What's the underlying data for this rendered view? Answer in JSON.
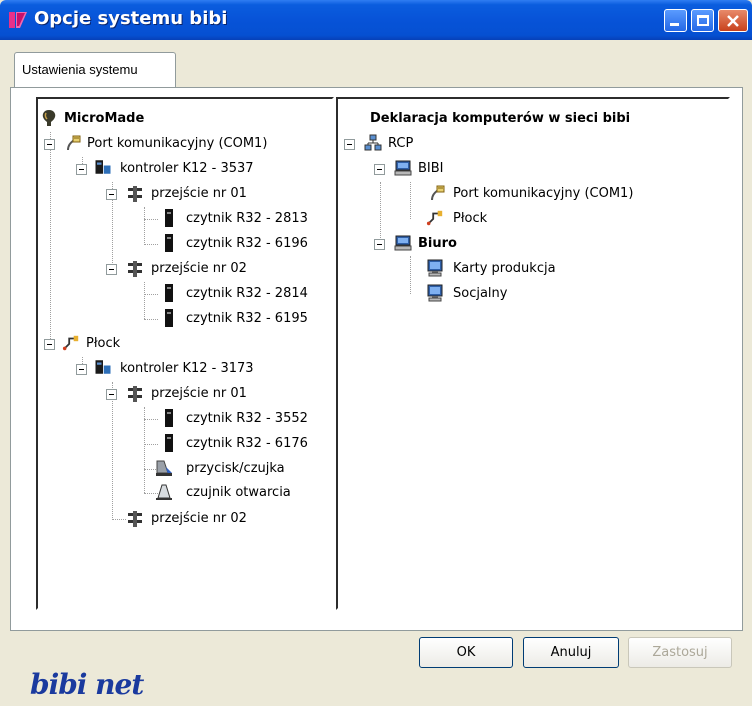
{
  "window": {
    "title": "Opcje systemu bibi"
  },
  "tabs": [
    {
      "label": "Ustawienia systemu"
    }
  ],
  "left_tree": {
    "root": "MicroMade",
    "nodes": [
      {
        "label": "Port komunikacyjny (COM1)",
        "icon": "serial-port-icon"
      },
      {
        "label": "kontroler K12 - 3537",
        "icon": "controller-icon"
      },
      {
        "label": "przejście nr 01",
        "icon": "passage-icon"
      },
      {
        "label": "czytnik R32 - 2813",
        "icon": "reader-icon"
      },
      {
        "label": "czytnik R32 - 6196",
        "icon": "reader-icon"
      },
      {
        "label": "przejście nr 02",
        "icon": "passage-icon"
      },
      {
        "label": "czytnik R32 - 2814",
        "icon": "reader-icon"
      },
      {
        "label": "czytnik R32 - 6195",
        "icon": "reader-icon"
      },
      {
        "label": "Płock",
        "icon": "network-link-icon"
      },
      {
        "label": "kontroler K12 - 3173",
        "icon": "controller-icon"
      },
      {
        "label": "przejście nr 01",
        "icon": "passage-icon"
      },
      {
        "label": "czytnik R32 - 3552",
        "icon": "reader-icon"
      },
      {
        "label": "czytnik R32 - 6176",
        "icon": "reader-icon"
      },
      {
        "label": "przycisk/czujka",
        "icon": "button-sensor-icon"
      },
      {
        "label": "czujnik otwarcia",
        "icon": "door-sensor-icon"
      },
      {
        "label": "przejście nr 02",
        "icon": "passage-icon"
      }
    ]
  },
  "right_tree": {
    "heading": "Deklaracja komputerów w sieci bibi",
    "nodes": [
      {
        "label": "RCP",
        "icon": "network-icon"
      },
      {
        "label": "BIBI",
        "icon": "computer-icon"
      },
      {
        "label": "Port komunikacyjny (COM1)",
        "icon": "serial-port-icon"
      },
      {
        "label": "Płock",
        "icon": "network-link-icon"
      },
      {
        "label": "Biuro",
        "icon": "computer-icon"
      },
      {
        "label": "Karty produkcja",
        "icon": "workstation-icon"
      },
      {
        "label": "Socjalny",
        "icon": "workstation-icon"
      }
    ]
  },
  "buttons": {
    "ok": "OK",
    "cancel": "Anuluj",
    "apply": "Zastosuj"
  },
  "footer": {
    "logo_text": "bibi net"
  },
  "colors": {
    "titlebar": "#0753D8",
    "face": "#ECE9D8",
    "logo": "#1A3A9E"
  }
}
